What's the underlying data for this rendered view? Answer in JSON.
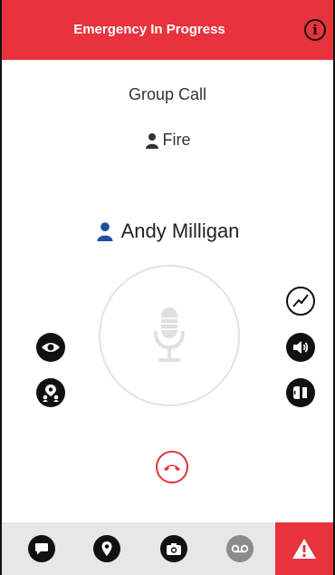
{
  "header": {
    "title": "Emergency In Progress",
    "info_icon": "info-icon",
    "background_color": "#e8323c"
  },
  "call": {
    "type": "Group Call",
    "group_name": "Fire",
    "speaker_name": "Andy Milligan",
    "speaker_icon_color": "#1f4fa3"
  },
  "left_controls": [
    {
      "icon": "eye-icon"
    },
    {
      "icon": "group-location-icon"
    }
  ],
  "right_controls": [
    {
      "icon": "activity-icon"
    },
    {
      "icon": "speaker-icon"
    },
    {
      "icon": "earpiece-icon"
    }
  ],
  "mic": {
    "icon": "microphone-icon",
    "state": "inactive"
  },
  "hangup": {
    "icon": "hang-up-icon",
    "color": "#e8323c"
  },
  "bottom_tabs": [
    {
      "icon": "chat-icon"
    },
    {
      "icon": "location-pin-icon"
    },
    {
      "icon": "camera-icon"
    },
    {
      "icon": "voicemail-icon"
    },
    {
      "icon": "emergency-alert-icon"
    }
  ]
}
